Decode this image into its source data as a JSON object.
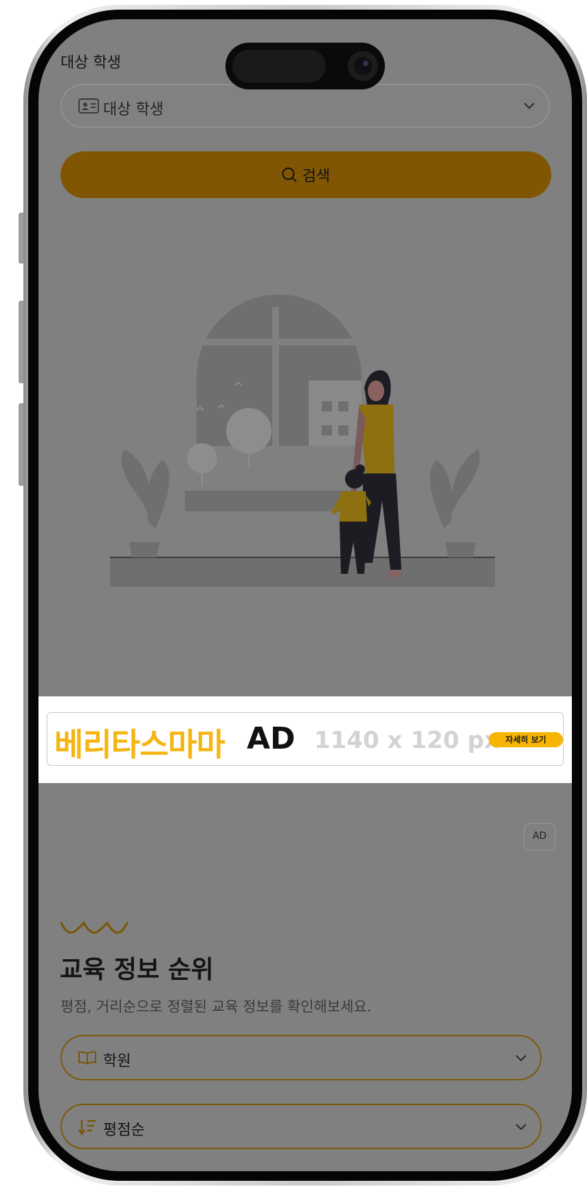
{
  "form": {
    "student_label": "대상 학생",
    "student_select_value": "대상 학생",
    "search_label": "검색"
  },
  "ad_banner": {
    "brand": "베리타스마마",
    "tag": "AD",
    "size_text": "1140 x 120 px",
    "more_label": "자세히 보기"
  },
  "ad_badge": "AD",
  "ranking": {
    "title": "교육 정보 순위",
    "description": "평점, 거리순으로 정렬된 교육 정보를 확인해보세요.",
    "category_value": "학원",
    "sort_value": "평점순"
  },
  "icons": {
    "student_select": "id-card-icon",
    "search": "search-icon",
    "dropdown": "chevron-down-icon",
    "category": "book-icon",
    "sort": "sort-descending-icon",
    "decoration": "squiggle-icon"
  },
  "colors": {
    "accent": "#805604",
    "ad_brand": "#f5b512",
    "overlay": "#808080"
  }
}
